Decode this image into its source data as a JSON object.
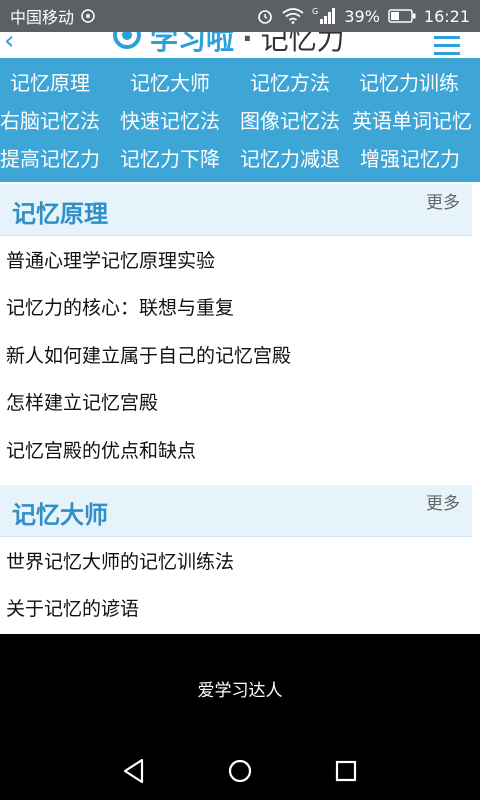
{
  "status_bar": {
    "carrier": "中国移动",
    "battery": "39%",
    "time": "16:21",
    "signal_label": "G"
  },
  "header": {
    "title": "学习啦",
    "separator": "·",
    "subtitle": "记忆力"
  },
  "categories": {
    "row1": [
      "记忆原理",
      "记忆大师",
      "记忆方法",
      "记忆力训练"
    ],
    "row2": [
      "右脑记忆法",
      "快速记忆法",
      "图像记忆法",
      "英语单词记忆"
    ],
    "row3": [
      "提高记忆力",
      "记忆力下降",
      "记忆力减退",
      "增强记忆力"
    ]
  },
  "sections": [
    {
      "title": "记忆原理",
      "more": "更多",
      "articles": [
        "普通心理学记忆原理实验",
        "记忆力的核心：联想与重复",
        "新人如何建立属于自己的记忆宫殿",
        "怎样建立记忆宫殿",
        "记忆宫殿的优点和缺点"
      ]
    },
    {
      "title": "记忆大师",
      "more": "更多",
      "articles": [
        "世界记忆大师的记忆训练法",
        "关于记忆的谚语"
      ]
    }
  ],
  "banner": {
    "text": "爱学习达人"
  },
  "colors": {
    "accent": "#3ea6d7",
    "section_bg": "#e7f3fa",
    "section_title": "#2f8fc7",
    "status_bar": "#5c5f63"
  }
}
